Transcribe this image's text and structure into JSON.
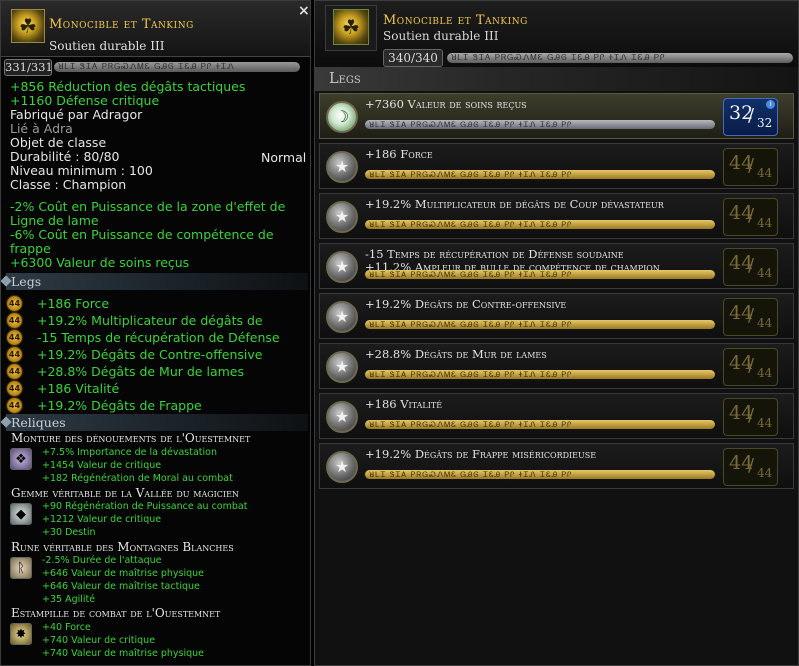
{
  "tooltip": {
    "name": "Monocible et Tanking",
    "subtitle": "Soutien durable III",
    "close": "×",
    "xp": "331/331",
    "bar_glyphs": "ꓤᏞᏆ ᏕᏆᎪ ᏢᏒᏀᏍᏁᎷᏋ ᏀᎯᎶ ᏆᏋᎯ ᏢᎵ ᏐᏆᏁ",
    "stats_top": [
      "+856 Réduction des dégâts tactiques",
      "+1160 Défense critique"
    ],
    "crafted_by": "Fabriqué par Adragor",
    "bound_to": "Lié à Adra",
    "item_type": "Objet de classe",
    "durability": "Durabilité : 80/80",
    "durability_class": "Normal",
    "min_level": "Niveau minimum : 100",
    "class": "Classe : Champion",
    "bonus_lines": [
      "-2% Coût en Puissance de la zone d'effet de",
      "Ligne de lame",
      "-6% Coût en Puissance de compétence de",
      "frappe",
      "+6300 Valeur de soins reçus"
    ],
    "legs_title": "Legs",
    "legs": [
      {
        "level": "44",
        "text": "+186 Force"
      },
      {
        "level": "44",
        "text": "+19.2% Multiplicateur de dégâts de"
      },
      {
        "level": "44",
        "text": "-15 Temps de récupération de Défense"
      },
      {
        "level": "44",
        "text": "+19.2% Dégâts de Contre-offensive"
      },
      {
        "level": "44",
        "text": "+28.8% Dégâts de Mur de lames"
      },
      {
        "level": "44",
        "text": "+186 Vitalité"
      },
      {
        "level": "44",
        "text": "+19.2% Dégâts de Frappe"
      }
    ],
    "relics_title": "Reliques",
    "relics": [
      {
        "name": "Monture des dénouements de l'Ouestemnet",
        "icon": "setting-icon",
        "stats": [
          "+7.5% Importance de la dévastation",
          "+1454 Valeur de critique",
          "+182 Régénération de Moral au combat"
        ]
      },
      {
        "name": "Gemme véritable de la Vallée du magicien",
        "icon": "gem-icon",
        "stats": [
          "+90 Régénération de Puissance au combat",
          "+1212 Valeur de critique",
          "+30 Destin"
        ]
      },
      {
        "name": "Rune véritable des Montagnes Blanches",
        "icon": "rune-icon",
        "stats": [
          "-2.5% Durée de l'attaque",
          "+646 Valeur de maîtrise physique",
          "+646 Valeur de maîtrise tactique",
          "+35 Agilité"
        ]
      },
      {
        "name": "Estampille de combat de l'Ouestemnet",
        "icon": "crest-icon",
        "stats": [
          "+40 Force",
          "+740 Valeur de critique",
          "+740 Valeur de maîtrise physique"
        ]
      }
    ]
  },
  "panel": {
    "name": "Monocible et Tanking",
    "subtitle": "Soutien durable III",
    "xp": "340/340",
    "bar_glyphs": "ꓤᏞᏆ ᏕᏆᎪ ᏢᏒᏀᏍᏁᎷᏋ ᏀᎯᎶ ᏆᏋᎯ ᏢᎵ ᏐᏆᏁ ᏆᏋᎯ ᏢᎵ",
    "legs_title": "Legs",
    "rows": [
      {
        "line1": "+7360 Valeur de soins reçus",
        "line2": "",
        "level": "32",
        "max": "32",
        "selected": true,
        "bar": "silver",
        "icon": "imbue-icon"
      },
      {
        "line1": "+186 Force",
        "line2": "",
        "level": "44",
        "max": "44",
        "selected": false,
        "bar": "gold",
        "icon": "star-icon"
      },
      {
        "line1": "+19.2% Multiplicateur de dégâts de Coup dévastateur",
        "line2": "",
        "level": "44",
        "max": "44",
        "selected": false,
        "bar": "gold",
        "icon": "star-icon"
      },
      {
        "line1": "-15 Temps de récupération de Défense soudaine",
        "line2": "+11.2% Ampleur de bulle de compétence de champion",
        "level": "44",
        "max": "44",
        "selected": false,
        "bar": "gold",
        "icon": "star-icon"
      },
      {
        "line1": "+19.2% Dégâts de Contre-offensive",
        "line2": "",
        "level": "44",
        "max": "44",
        "selected": false,
        "bar": "gold",
        "icon": "star-icon"
      },
      {
        "line1": "+28.8% Dégâts de Mur de lames",
        "line2": "",
        "level": "44",
        "max": "44",
        "selected": false,
        "bar": "gold",
        "icon": "star-icon"
      },
      {
        "line1": "+186 Vitalité",
        "line2": "",
        "level": "44",
        "max": "44",
        "selected": false,
        "bar": "gold",
        "icon": "star-icon"
      },
      {
        "line1": "+19.2% Dégâts de Frappe miséricordieuse",
        "line2": "",
        "level": "44",
        "max": "44",
        "selected": false,
        "bar": "gold",
        "icon": "star-icon"
      }
    ]
  },
  "colors": {
    "name_gold": "#f0c850",
    "stat_green": "#3ed23e",
    "level_blue": "#10306a"
  }
}
